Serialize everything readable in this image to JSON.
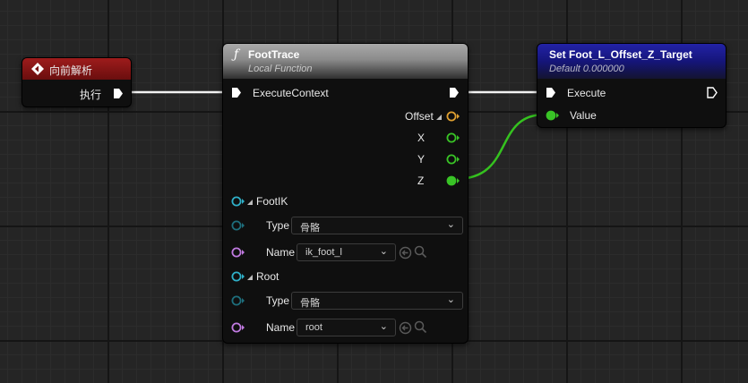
{
  "event_node": {
    "title": "向前解析",
    "exec_out_label": "执行",
    "colors": {
      "header": "#8a1414",
      "accent": "#ffffff"
    }
  },
  "foottrace_node": {
    "title": "FootTrace",
    "subtitle": "Local Function",
    "function_glyph": "ƒ",
    "exec_in_label": "ExecuteContext",
    "outputs": {
      "offset": "Offset",
      "x": "X",
      "y": "Y",
      "z": "Z"
    },
    "footik": {
      "label": "FootIK",
      "type_label": "Type",
      "type_value": "骨骼",
      "name_label": "Name",
      "name_value": "ik_foot_l"
    },
    "root": {
      "label": "Root",
      "type_label": "Type",
      "type_value": "骨骼",
      "name_label": "Name",
      "name_value": "root"
    },
    "colors": {
      "header": "#8f8f8f",
      "struct_pin": "#e0a030",
      "float_pin": "#39c426",
      "key_pin": "#2fb0c8",
      "name_pin": "#c07ae0"
    }
  },
  "set_node": {
    "title": "Set Foot_L_Offset_Z_Target",
    "subtitle": "Default 0.000000",
    "exec_in_label": "Execute",
    "value_label": "Value",
    "colors": {
      "header": "#1c1c8c",
      "value_pin": "#39c426"
    }
  },
  "icons": {
    "event": "event-diamond-icon",
    "exec": "exec-arrow-icon",
    "reset": "reset-arrow-icon",
    "search": "magnifier-icon",
    "chevron": "chevron-down-icon"
  },
  "wires": {
    "exec_color": "#ffffff",
    "float_color": "#39c426"
  }
}
